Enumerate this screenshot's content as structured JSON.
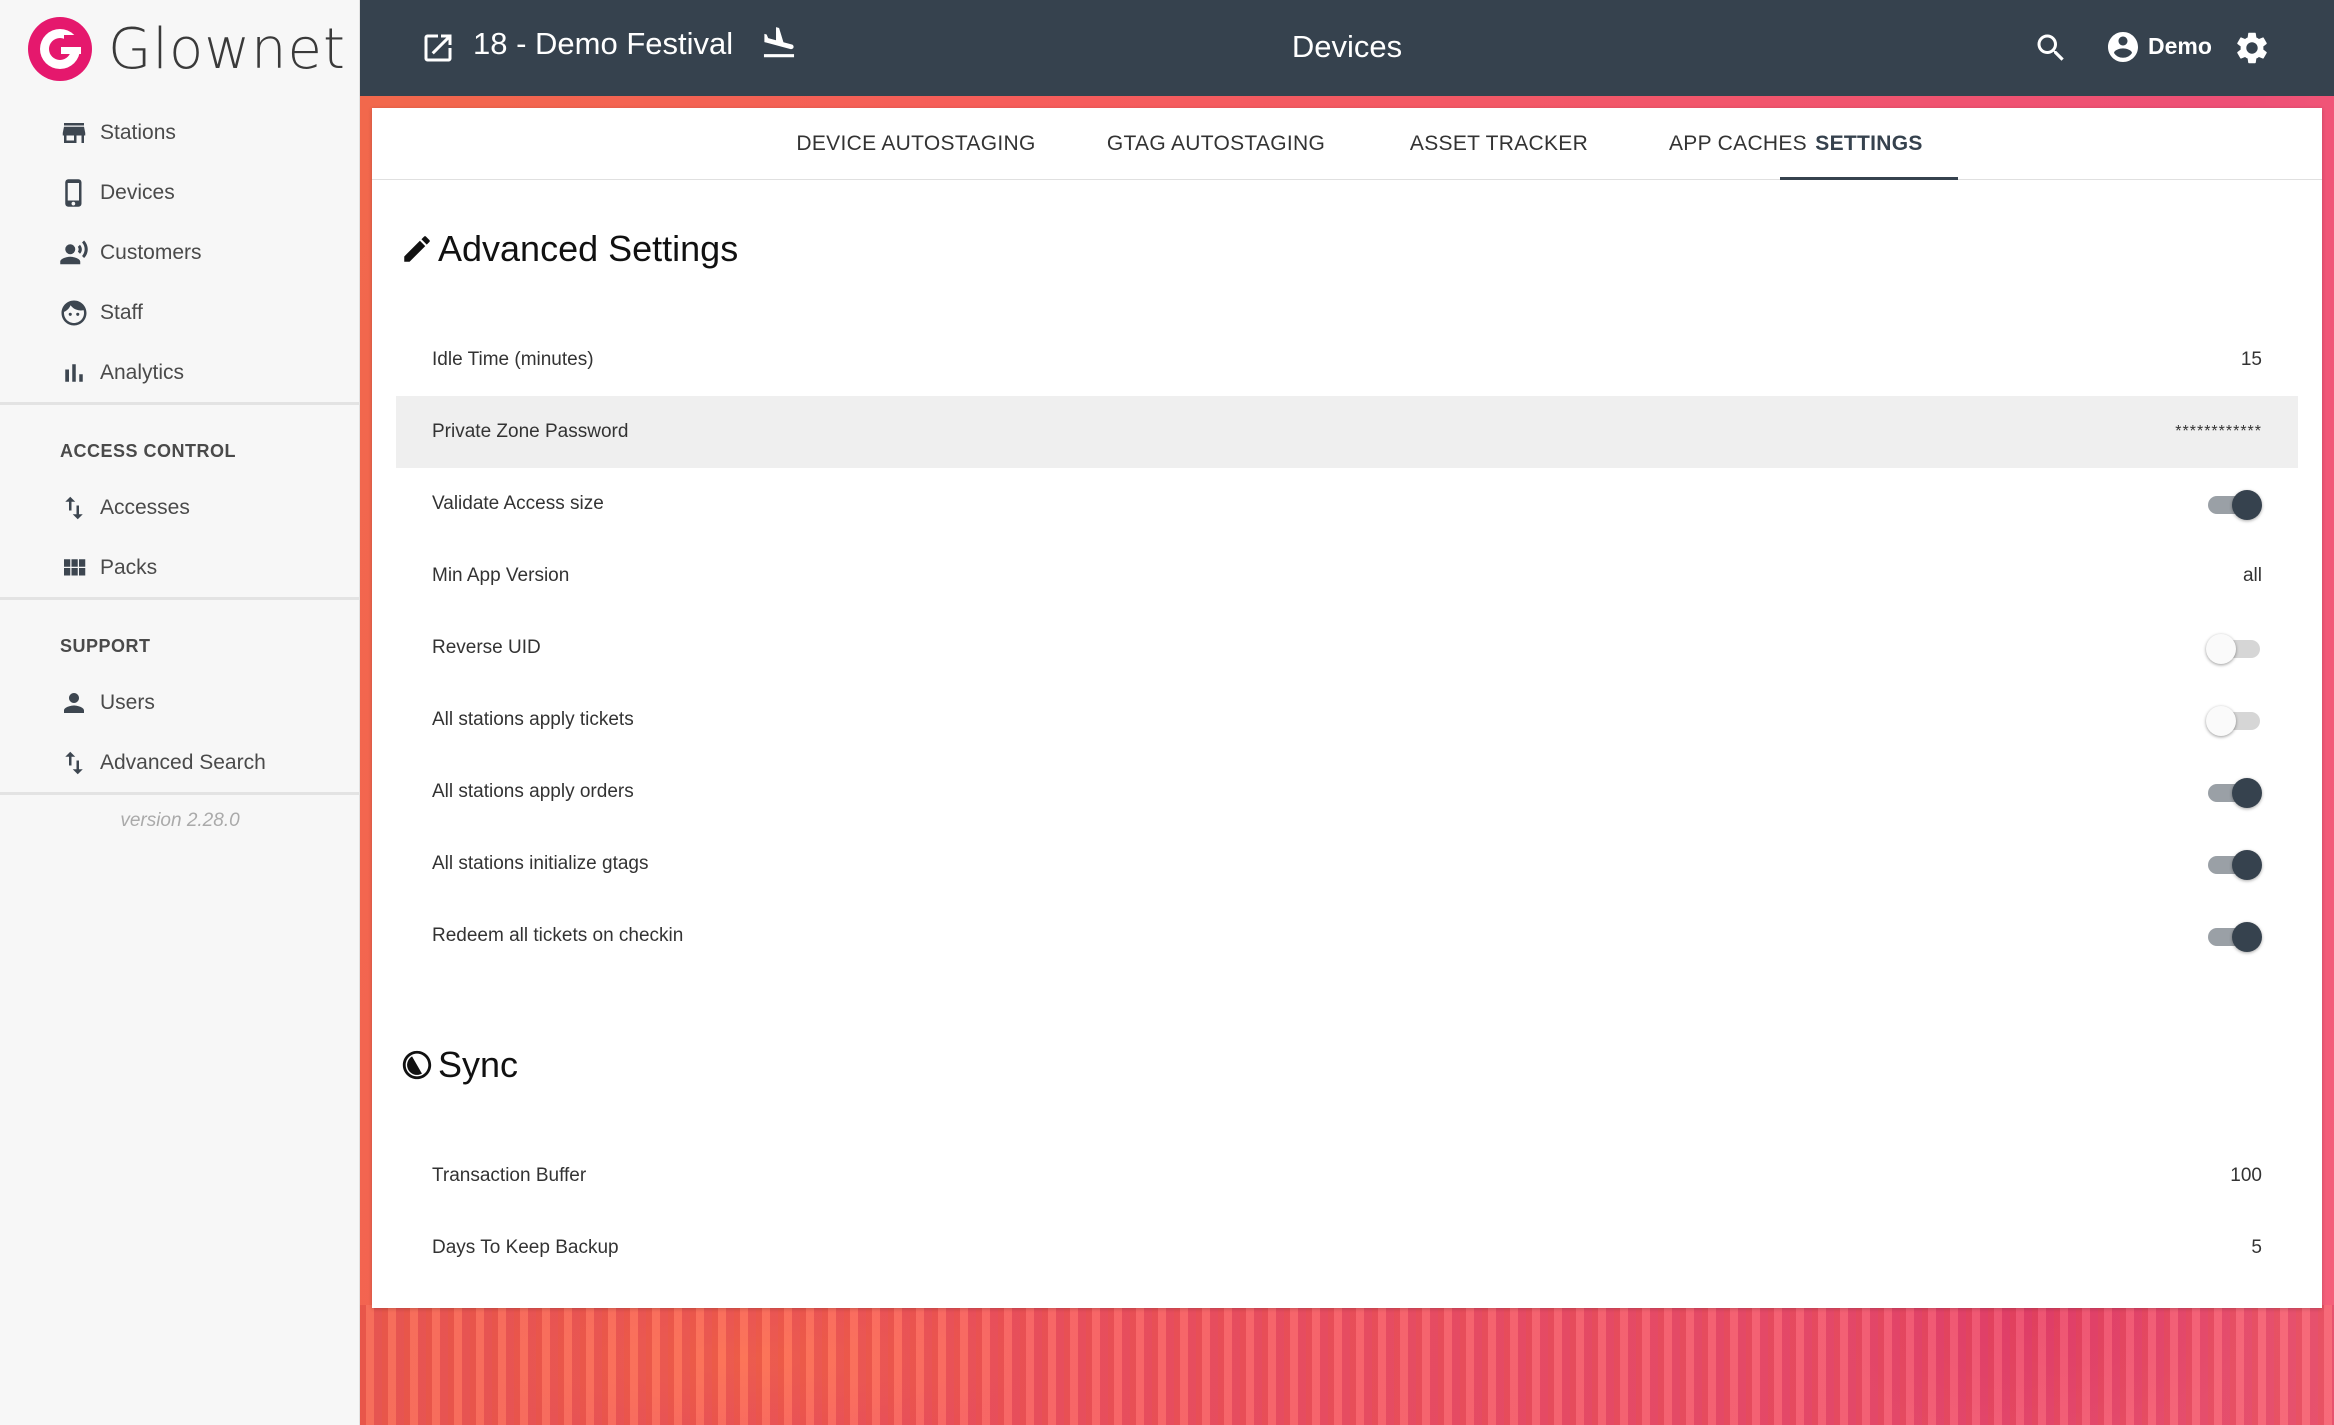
{
  "brand": {
    "name": "Glownet"
  },
  "sidebar": {
    "items": [
      {
        "label": "Stations",
        "icon": "store-icon"
      },
      {
        "label": "Devices",
        "icon": "phone-icon"
      },
      {
        "label": "Customers",
        "icon": "customer-voice-icon"
      },
      {
        "label": "Staff",
        "icon": "face-icon"
      },
      {
        "label": "Analytics",
        "icon": "bar-chart-icon"
      }
    ],
    "access_control": {
      "title": "ACCESS CONTROL",
      "items": [
        {
          "label": "Accesses",
          "icon": "swap-vert-icon"
        },
        {
          "label": "Packs",
          "icon": "grid-icon"
        }
      ]
    },
    "support": {
      "title": "SUPPORT",
      "items": [
        {
          "label": "Users",
          "icon": "person-icon"
        },
        {
          "label": "Advanced Search",
          "icon": "swap-vert-icon"
        }
      ]
    },
    "version": "version 2.28.0"
  },
  "topbar": {
    "event_name": "18 - Demo Festival",
    "page_title": "Devices",
    "user_name": "Demo"
  },
  "tabs": [
    {
      "label": "DEVICE AUTOSTAGING",
      "active": false
    },
    {
      "label": "GTAG AUTOSTAGING",
      "active": false
    },
    {
      "label": "ASSET TRACKER",
      "active": false
    },
    {
      "label": "APP CACHES",
      "active": false
    },
    {
      "label": "SETTINGS",
      "active": true
    }
  ],
  "advanced_settings": {
    "title": "Advanced Settings",
    "rows": [
      {
        "label": "Idle Time (minutes)",
        "value": "15"
      },
      {
        "label": "Private Zone Password",
        "value": "************"
      },
      {
        "label": "Validate Access size",
        "toggle": true
      },
      {
        "label": "Min App Version",
        "value": "all"
      },
      {
        "label": "Reverse UID",
        "toggle": false
      },
      {
        "label": "All stations apply tickets",
        "toggle": false
      },
      {
        "label": "All stations apply orders",
        "toggle": true
      },
      {
        "label": "All stations initialize gtags",
        "toggle": true
      },
      {
        "label": "Redeem all tickets on checkin",
        "toggle": true
      }
    ]
  },
  "sync": {
    "title": "Sync",
    "rows": [
      {
        "label": "Transaction Buffer",
        "value": "100"
      },
      {
        "label": "Days To Keep Backup",
        "value": "5"
      }
    ]
  },
  "colors": {
    "brand": "#e5186d",
    "topbar": "#36424e",
    "toggle_on": "#36424e"
  }
}
